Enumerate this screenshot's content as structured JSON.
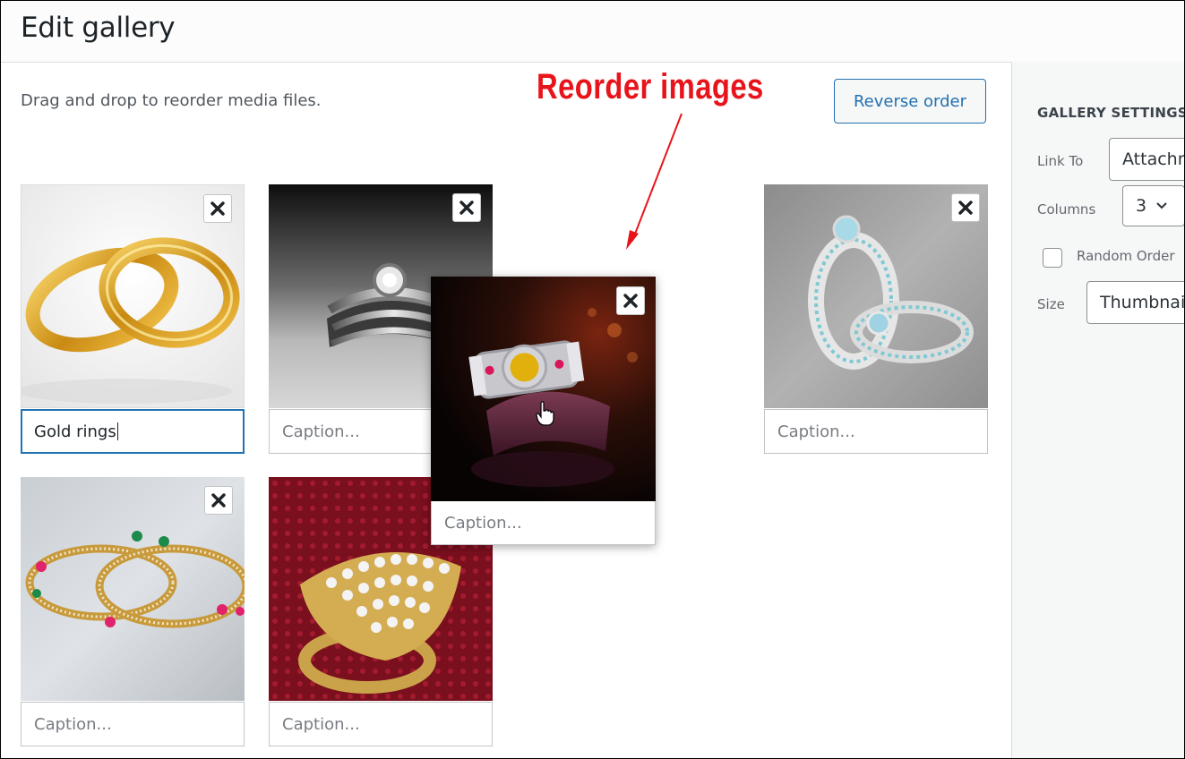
{
  "page": {
    "title": "Edit gallery"
  },
  "toolbar": {
    "hint": "Drag and drop to reorder media files.",
    "reverse_label": "Reverse order"
  },
  "annotation": {
    "text": "Reorder images",
    "color": "#e8141b"
  },
  "gallery": {
    "items": [
      {
        "alt": "gold rings",
        "caption_value": "Gold rings",
        "caption_placeholder": "Caption..."
      },
      {
        "alt": "diamond ring set",
        "caption_value": "",
        "caption_placeholder": "Caption..."
      },
      {
        "alt": "silver rings with blue stones",
        "caption_value": "",
        "caption_placeholder": "Caption..."
      },
      {
        "alt": "jeweled bangles",
        "caption_value": "",
        "caption_placeholder": "Caption..."
      },
      {
        "alt": "gold diamond ring on red lace",
        "caption_value": "",
        "caption_placeholder": "Caption..."
      }
    ],
    "dragged": {
      "alt": "ornate ring with yellow stone",
      "caption_placeholder": "Caption..."
    }
  },
  "settings": {
    "heading": "GALLERY SETTINGS",
    "link_to_label": "Link To",
    "link_to_value": "Attachment Page",
    "columns_label": "Columns",
    "columns_value": "3",
    "random_label": "Random Order",
    "size_label": "Size",
    "size_value": "Thumbnail"
  },
  "icons": {
    "remove": "close-icon",
    "cursor": "hand-pointer-icon",
    "dropdown": "chevron-down-icon"
  },
  "colors": {
    "accent": "#2271b1",
    "annotation": "#e8141b"
  }
}
